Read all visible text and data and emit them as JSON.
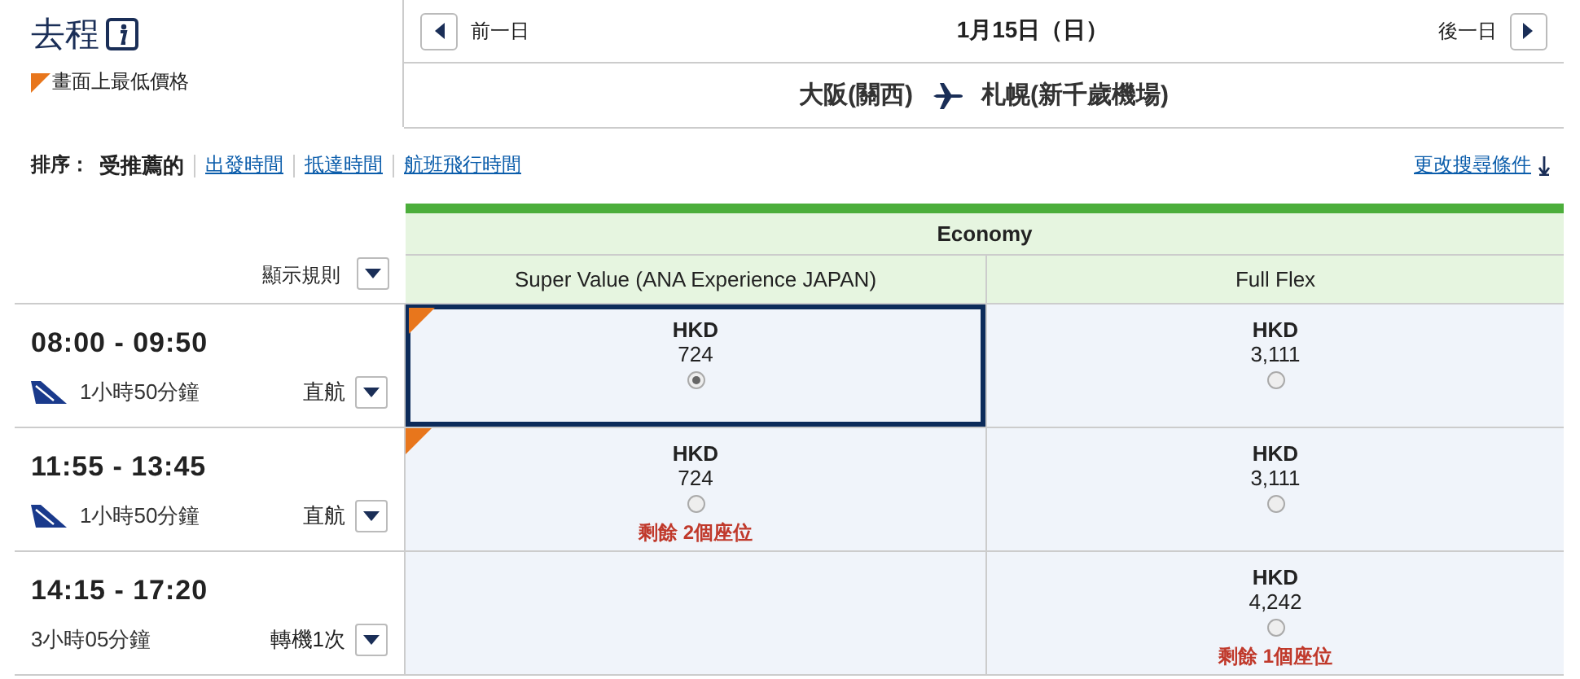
{
  "heading": {
    "title": "去程",
    "legend": "畫面上最低價格"
  },
  "date_nav": {
    "prev": "前一日",
    "date": "1月15日（日）",
    "next": "後一日"
  },
  "route": {
    "origin": "大阪(關西)",
    "destination": "札幌(新千歲機場)"
  },
  "sort": {
    "label": "排序：",
    "options": [
      {
        "label": "受推薦的",
        "selected": true
      },
      {
        "label": "出發時間",
        "selected": false
      },
      {
        "label": "抵達時間",
        "selected": false
      },
      {
        "label": "航班飛行時間",
        "selected": false
      }
    ],
    "change_search": "更改搜尋條件"
  },
  "cabin": "Economy",
  "display_rule": "顯示規則",
  "fare_columns": [
    "Super Value (ANA Experience JAPAN)",
    "Full Flex"
  ],
  "flights": [
    {
      "time": "08:00 - 09:50",
      "airline_logo": true,
      "duration": "1小時50分鐘",
      "stops": "直航",
      "fares": [
        {
          "currency": "HKD",
          "amount": "724",
          "selected": true,
          "lowest": true
        },
        {
          "currency": "HKD",
          "amount": "3,111",
          "selected": false,
          "lowest": false
        }
      ]
    },
    {
      "time": "11:55 - 13:45",
      "airline_logo": true,
      "duration": "1小時50分鐘",
      "stops": "直航",
      "fares": [
        {
          "currency": "HKD",
          "amount": "724",
          "selected": false,
          "lowest": true,
          "seats": "剩餘 2個座位"
        },
        {
          "currency": "HKD",
          "amount": "3,111",
          "selected": false,
          "lowest": false
        }
      ]
    },
    {
      "time": "14:15 - 17:20",
      "airline_logo": false,
      "duration": "3小時05分鐘",
      "stops": "轉機1次",
      "fares": [
        {
          "kind": "unavailable"
        },
        {
          "currency": "HKD",
          "amount": "4,242",
          "selected": false,
          "lowest": false,
          "seats": "剩餘 1個座位"
        }
      ]
    }
  ]
}
